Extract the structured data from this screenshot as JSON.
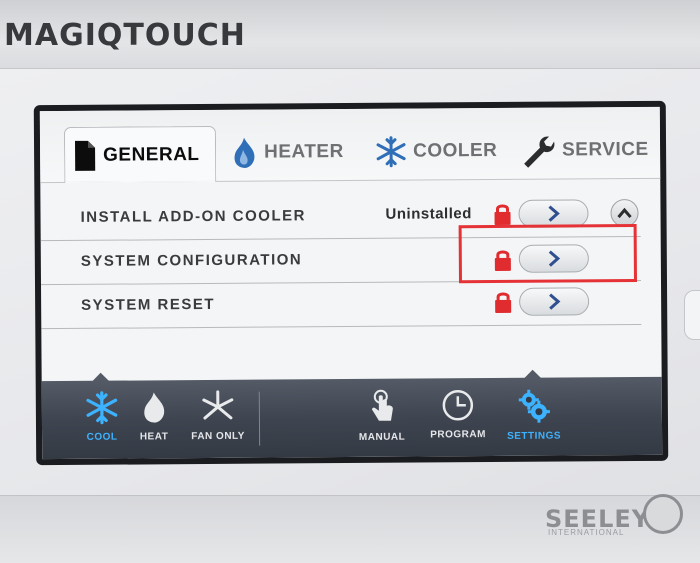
{
  "device": {
    "brand": "MAGIQTOUCH",
    "maker": "SEELEY",
    "maker_sub": "INTERNATIONAL"
  },
  "tabs": [
    {
      "label": "GENERAL",
      "icon": "document-icon",
      "active": true
    },
    {
      "label": "HEATER",
      "icon": "flame-icon",
      "active": false
    },
    {
      "label": "COOLER",
      "icon": "snowflake-icon",
      "active": false
    },
    {
      "label": "SERVICE",
      "icon": "wrench-icon",
      "active": false
    }
  ],
  "rows": [
    {
      "label": "INSTALL ADD-ON COOLER",
      "value": "Uninstalled",
      "locked": true,
      "has_up": true
    },
    {
      "label": "SYSTEM CONFIGURATION",
      "value": "",
      "locked": true,
      "highlighted": true
    },
    {
      "label": "SYSTEM RESET",
      "value": "",
      "locked": true
    }
  ],
  "modes": [
    {
      "label": "COOL",
      "icon": "snowflake-icon",
      "active": true
    },
    {
      "label": "HEAT",
      "icon": "flame-icon",
      "active": false
    },
    {
      "label": "FAN ONLY",
      "icon": "fan-icon",
      "active": false
    }
  ],
  "controls": [
    {
      "label": "MANUAL",
      "icon": "hand-touch-icon",
      "active": false
    },
    {
      "label": "PROGRAM",
      "icon": "clock-icon",
      "active": false
    },
    {
      "label": "SETTINGS",
      "icon": "gears-icon",
      "active": true
    }
  ],
  "colors": {
    "active_blue": "#3db2ff",
    "lock_red": "#e02b2f",
    "highlight_red": "#e53236",
    "bar_dark": "#3f4550"
  }
}
